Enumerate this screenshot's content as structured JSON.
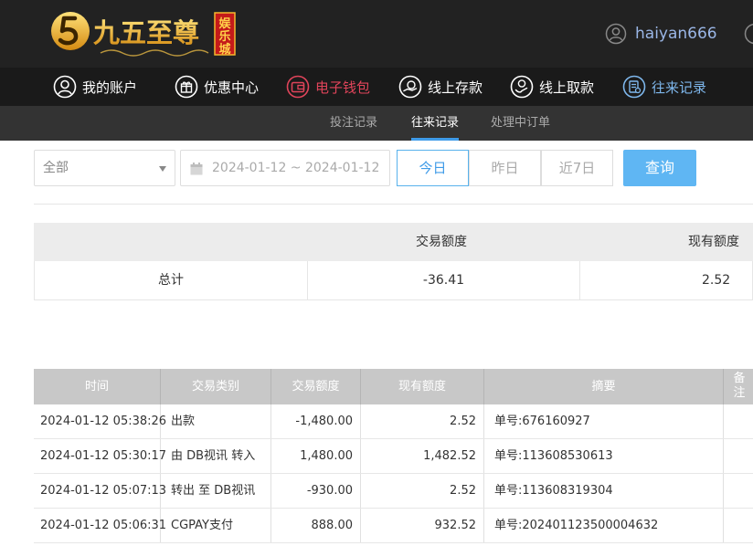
{
  "brand": {
    "name": "九五至尊",
    "tag": "娱乐城"
  },
  "user": {
    "name": "haiyan666"
  },
  "nav": {
    "items": [
      {
        "label": "我的账户",
        "icon": "user-circle-icon"
      },
      {
        "label": "优惠中心",
        "icon": "gift-icon"
      },
      {
        "label": "电子钱包",
        "icon": "wallet-icon"
      },
      {
        "label": "线上存款",
        "icon": "deposit-icon"
      },
      {
        "label": "线上取款",
        "icon": "withdraw-icon"
      },
      {
        "label": "往来记录",
        "icon": "records-icon"
      }
    ]
  },
  "subnav": {
    "items": [
      "投注记录",
      "往来记录",
      "处理中订单"
    ],
    "active": "往来记录"
  },
  "filter": {
    "type_value": "全部",
    "date_range": "2024-01-12 ~ 2024-01-12",
    "quick_ranges": [
      "今日",
      "昨日",
      "近7日"
    ],
    "active_range": "今日",
    "query_label": "查询"
  },
  "summary": {
    "headers": [
      "交易额度",
      "现有额度"
    ],
    "row_label": "总计",
    "trade_total": "-36.41",
    "balance": "2.52"
  },
  "records": {
    "headers": [
      "时间",
      "交易类别",
      "交易额度",
      "现有额度",
      "摘要",
      "备注"
    ],
    "rows": [
      {
        "time": "2024-01-12 05:38:26",
        "type": "出款",
        "amount": "-1,480.00",
        "balance": "2.52",
        "memo": "单号:676160927",
        "note": ""
      },
      {
        "time": "2024-01-12 05:30:17",
        "type": "由 DB视讯 转入",
        "amount": "1,480.00",
        "balance": "1,482.52",
        "memo": "单号:113608530613",
        "note": ""
      },
      {
        "time": "2024-01-12 05:07:13",
        "type": "转出 至 DB视讯",
        "amount": "-930.00",
        "balance": "2.52",
        "memo": "单号:113608319304",
        "note": ""
      },
      {
        "time": "2024-01-12 05:06:31",
        "type": "CGPAY支付",
        "amount": "888.00",
        "balance": "932.52",
        "memo": "单号:20240112350000463​2",
        "note": ""
      }
    ]
  },
  "colors": {
    "accent": "#3f9be8",
    "gold": "#f5b82e",
    "wallet_red": "#e0445a",
    "header_bg": "#222222"
  }
}
